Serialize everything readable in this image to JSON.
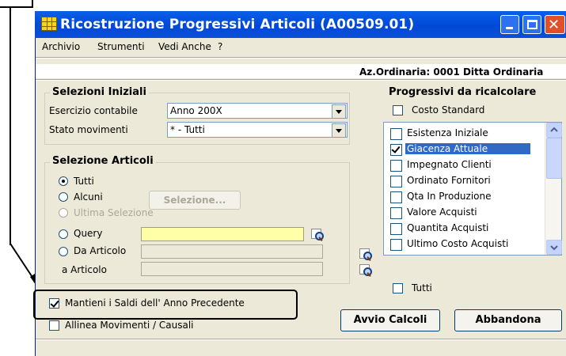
{
  "window": {
    "title": "Ricostruzione Progressivi Articoli (A00509.01)",
    "accent": "#0a5fe8"
  },
  "menu": [
    {
      "label": "Archivio"
    },
    {
      "label": "Strumenti"
    },
    {
      "label": "Vedi Anche"
    },
    {
      "label": "?"
    }
  ],
  "company": "Az.Ordinaria: 0001 Ditta Ordinaria",
  "initial_selections": {
    "title": "Selezioni Iniziali",
    "fiscal_year_label": "Esercizio contabile",
    "fiscal_year_value": "Anno 200X",
    "movement_state_label": "Stato movimenti",
    "movement_state_value": "* - Tutti"
  },
  "article_selection": {
    "title": "Selezione Articoli",
    "options": {
      "all": "Tutti",
      "some": "Alcuni",
      "last_selection": "Ultima Selezione",
      "query": "Query",
      "from_article": "Da  Articolo",
      "to_article": "a    Articolo"
    },
    "selection_button": "Selezione...",
    "selected": "Tutti"
  },
  "progressives": {
    "title": "Progressivi da ricalcolare",
    "standard_cost": "Costo Standard",
    "items": [
      {
        "label": "Esistenza Iniziale",
        "checked": false
      },
      {
        "label": "Giacenza Attuale",
        "checked": true
      },
      {
        "label": "Impegnato Clienti",
        "checked": false
      },
      {
        "label": "Ordinato Fornitori",
        "checked": false
      },
      {
        "label": "Qta In Produzione",
        "checked": false
      },
      {
        "label": "Valore Acquisti",
        "checked": false
      },
      {
        "label": "Quantita Acquisti",
        "checked": false
      },
      {
        "label": "Ultimo Costo Acquisti",
        "checked": false
      }
    ],
    "all_label": "Tutti"
  },
  "options": {
    "keep_balances": "Mantieni i Saldi dell' Anno Precedente",
    "keep_balances_checked": true,
    "align_movements": "Allinea Movimenti / Causali",
    "align_movements_checked": false
  },
  "buttons": {
    "start": "Avvio Calcoli",
    "cancel": "Abbandona"
  }
}
